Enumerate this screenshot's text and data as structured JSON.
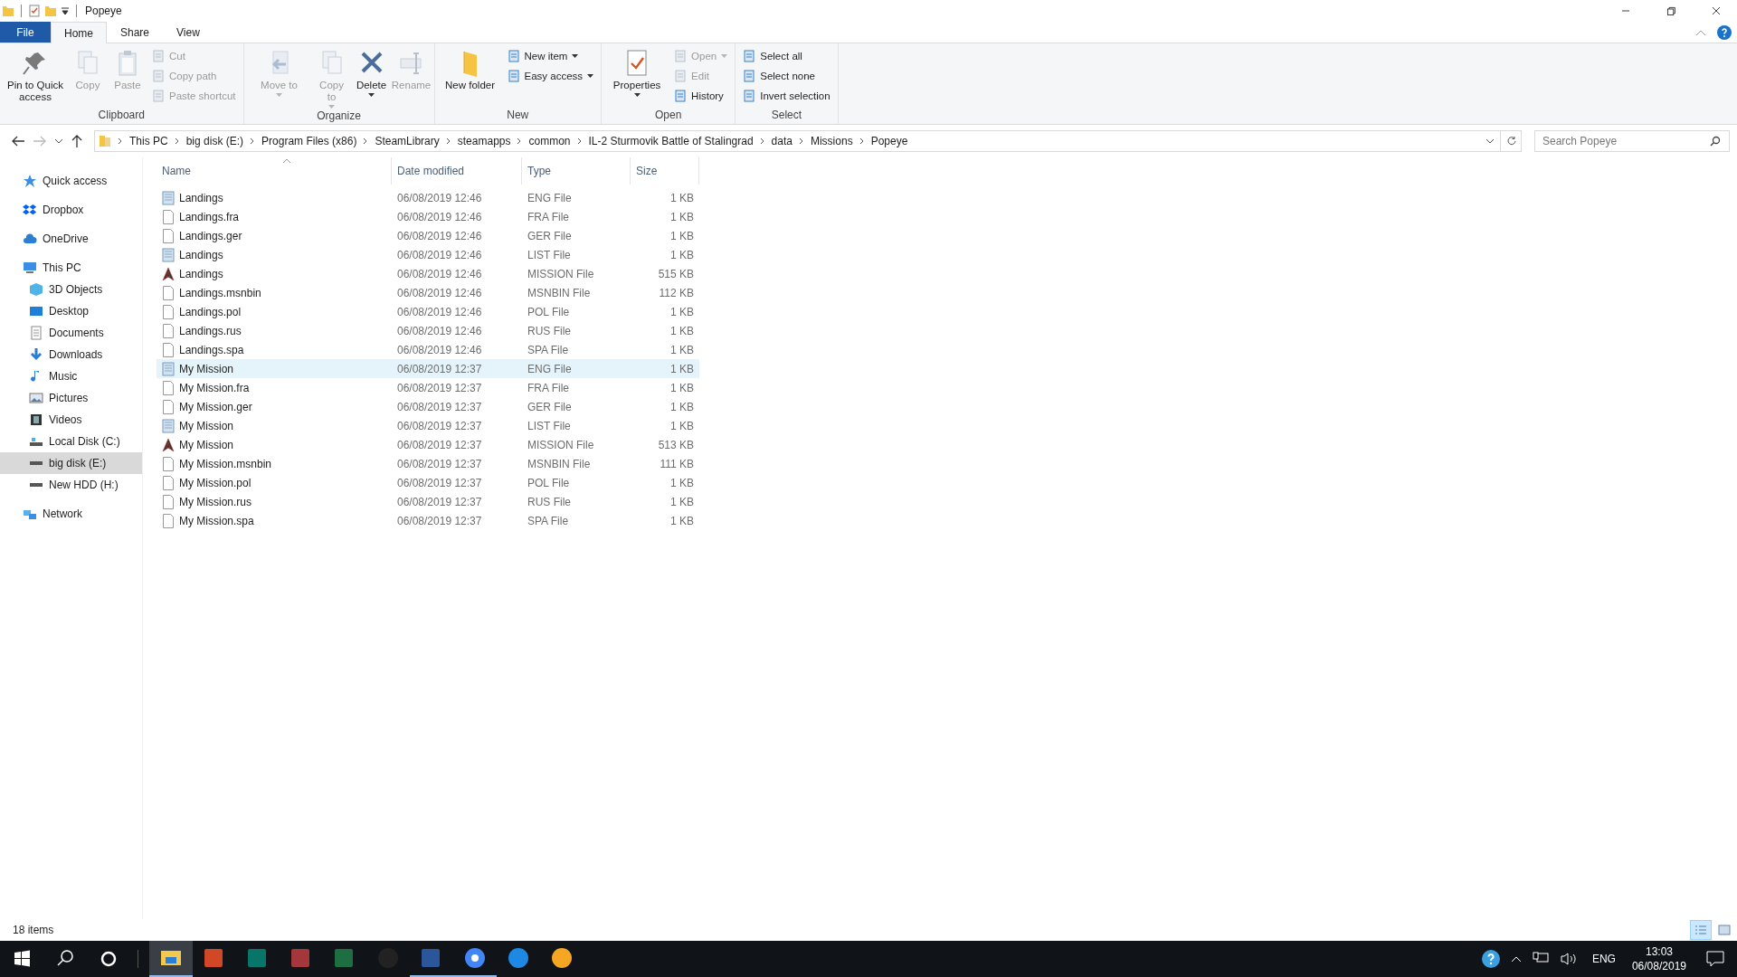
{
  "window": {
    "title": "Popeye"
  },
  "tabs": [
    {
      "label": "File",
      "kind": "file",
      "selected": false
    },
    {
      "label": "Home",
      "kind": "tab",
      "selected": true
    },
    {
      "label": "Share",
      "kind": "tab",
      "selected": false
    },
    {
      "label": "View",
      "kind": "tab",
      "selected": false
    }
  ],
  "ribbon": [
    {
      "label": "Clipboard",
      "items": [
        {
          "kind": "large",
          "label": "Pin to Quick access",
          "disabled": false,
          "dropdown": false
        },
        {
          "kind": "large",
          "label": "Copy",
          "disabled": true,
          "dropdown": false
        },
        {
          "kind": "large",
          "label": "Paste",
          "disabled": true,
          "dropdown": false
        },
        {
          "kind": "stack",
          "buttons": [
            {
              "label": "Cut",
              "disabled": true,
              "dropdown": false
            },
            {
              "label": "Copy path",
              "disabled": true,
              "dropdown": false
            },
            {
              "label": "Paste shortcut",
              "disabled": true,
              "dropdown": false
            }
          ]
        }
      ]
    },
    {
      "label": "Organize",
      "items": [
        {
          "kind": "large",
          "label": "Move to",
          "disabled": true,
          "dropdown": true
        },
        {
          "kind": "large",
          "label": "Copy to",
          "disabled": true,
          "dropdown": true
        },
        {
          "kind": "large",
          "label": "Delete",
          "disabled": false,
          "dropdown": true
        },
        {
          "kind": "large",
          "label": "Rename",
          "disabled": true,
          "dropdown": false
        }
      ]
    },
    {
      "label": "New",
      "items": [
        {
          "kind": "large",
          "label": "New folder",
          "disabled": false,
          "dropdown": false
        },
        {
          "kind": "stack",
          "buttons": [
            {
              "label": "New item",
              "disabled": false,
              "dropdown": true
            },
            {
              "label": "Easy access",
              "disabled": false,
              "dropdown": true
            }
          ]
        }
      ]
    },
    {
      "label": "Open",
      "items": [
        {
          "kind": "large",
          "label": "Properties",
          "disabled": false,
          "dropdown": true
        },
        {
          "kind": "stack",
          "buttons": [
            {
              "label": "Open",
              "disabled": true,
              "dropdown": true
            },
            {
              "label": "Edit",
              "disabled": true,
              "dropdown": false
            },
            {
              "label": "History",
              "disabled": false,
              "dropdown": false
            }
          ]
        }
      ]
    },
    {
      "label": "Select",
      "items": [
        {
          "kind": "stack",
          "buttons": [
            {
              "label": "Select all",
              "disabled": false,
              "dropdown": false
            },
            {
              "label": "Select none",
              "disabled": false,
              "dropdown": false
            },
            {
              "label": "Invert selection",
              "disabled": false,
              "dropdown": false
            }
          ]
        }
      ]
    }
  ],
  "address": {
    "path": [
      "This PC",
      "big disk (E:)",
      "Program Files (x86)",
      "SteamLibrary",
      "steamapps",
      "common",
      "IL-2 Sturmovik Battle of Stalingrad",
      "data",
      "Missions",
      "Popeye"
    ]
  },
  "search": {
    "placeholder": "Search Popeye"
  },
  "sidebar": {
    "items": [
      {
        "label": "Quick access",
        "selected": false
      },
      {
        "label": "Dropbox",
        "selected": false
      },
      {
        "label": "OneDrive",
        "selected": false
      },
      {
        "label": "This PC",
        "selected": false,
        "children": [
          {
            "label": "3D Objects",
            "selected": false
          },
          {
            "label": "Desktop",
            "selected": false
          },
          {
            "label": "Documents",
            "selected": false
          },
          {
            "label": "Downloads",
            "selected": false
          },
          {
            "label": "Music",
            "selected": false
          },
          {
            "label": "Pictures",
            "selected": false
          },
          {
            "label": "Videos",
            "selected": false
          },
          {
            "label": "Local Disk (C:)",
            "selected": false
          },
          {
            "label": "big disk (E:)",
            "selected": true
          },
          {
            "label": "New HDD (H:)",
            "selected": false
          }
        ]
      },
      {
        "label": "Network",
        "selected": false
      }
    ]
  },
  "table": {
    "columns": [
      "Name",
      "Date modified",
      "Type",
      "Size"
    ],
    "rows": [
      {
        "kind": "text",
        "name": "Landings",
        "date": "06/08/2019 12:46",
        "type": "ENG File",
        "size": "1 KB",
        "selected": false
      },
      {
        "kind": "blank",
        "name": "Landings.fra",
        "date": "06/08/2019 12:46",
        "type": "FRA File",
        "size": "1 KB",
        "selected": false
      },
      {
        "kind": "blank",
        "name": "Landings.ger",
        "date": "06/08/2019 12:46",
        "type": "GER File",
        "size": "1 KB",
        "selected": false
      },
      {
        "kind": "text",
        "name": "Landings",
        "date": "06/08/2019 12:46",
        "type": "LIST File",
        "size": "1 KB",
        "selected": false
      },
      {
        "kind": "mission",
        "name": "Landings",
        "date": "06/08/2019 12:46",
        "type": "MISSION File",
        "size": "515 KB",
        "selected": false
      },
      {
        "kind": "blank",
        "name": "Landings.msnbin",
        "date": "06/08/2019 12:46",
        "type": "MSNBIN File",
        "size": "112 KB",
        "selected": false
      },
      {
        "kind": "blank",
        "name": "Landings.pol",
        "date": "06/08/2019 12:46",
        "type": "POL File",
        "size": "1 KB",
        "selected": false
      },
      {
        "kind": "blank",
        "name": "Landings.rus",
        "date": "06/08/2019 12:46",
        "type": "RUS File",
        "size": "1 KB",
        "selected": false
      },
      {
        "kind": "blank",
        "name": "Landings.spa",
        "date": "06/08/2019 12:46",
        "type": "SPA File",
        "size": "1 KB",
        "selected": false
      },
      {
        "kind": "text",
        "name": "My Mission",
        "date": "06/08/2019 12:37",
        "type": "ENG File",
        "size": "1 KB",
        "selected": true
      },
      {
        "kind": "blank",
        "name": "My Mission.fra",
        "date": "06/08/2019 12:37",
        "type": "FRA File",
        "size": "1 KB",
        "selected": false
      },
      {
        "kind": "blank",
        "name": "My Mission.ger",
        "date": "06/08/2019 12:37",
        "type": "GER File",
        "size": "1 KB",
        "selected": false
      },
      {
        "kind": "text",
        "name": "My Mission",
        "date": "06/08/2019 12:37",
        "type": "LIST File",
        "size": "1 KB",
        "selected": false
      },
      {
        "kind": "mission",
        "name": "My Mission",
        "date": "06/08/2019 12:37",
        "type": "MISSION File",
        "size": "513 KB",
        "selected": false
      },
      {
        "kind": "blank",
        "name": "My Mission.msnbin",
        "date": "06/08/2019 12:37",
        "type": "MSNBIN File",
        "size": "111 KB",
        "selected": false
      },
      {
        "kind": "blank",
        "name": "My Mission.pol",
        "date": "06/08/2019 12:37",
        "type": "POL File",
        "size": "1 KB",
        "selected": false
      },
      {
        "kind": "blank",
        "name": "My Mission.rus",
        "date": "06/08/2019 12:37",
        "type": "RUS File",
        "size": "1 KB",
        "selected": false
      },
      {
        "kind": "blank",
        "name": "My Mission.spa",
        "date": "06/08/2019 12:37",
        "type": "SPA File",
        "size": "1 KB",
        "selected": false
      }
    ]
  },
  "status_bar": {
    "text": "18 items",
    "views": [
      {
        "selected": true
      },
      {
        "selected": false
      }
    ]
  },
  "taskbar": {
    "apps": [
      {
        "selected": true,
        "running": true
      },
      {
        "selected": false,
        "running": false
      },
      {
        "selected": false,
        "running": false
      },
      {
        "selected": false,
        "running": false
      },
      {
        "selected": false,
        "running": false
      },
      {
        "selected": false,
        "running": false
      },
      {
        "selected": false,
        "running": true
      },
      {
        "selected": false,
        "running": true
      },
      {
        "selected": false,
        "running": false
      },
      {
        "selected": false,
        "running": false
      }
    ],
    "language": "ENG",
    "time": "13:03",
    "date": "06/08/2019"
  }
}
